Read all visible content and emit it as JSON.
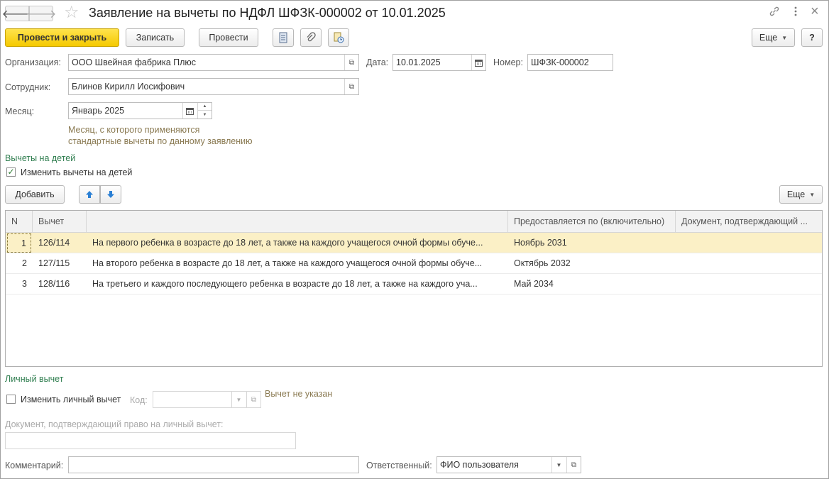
{
  "window": {
    "title": "Заявление на вычеты по НДФЛ ШФЗК-000002 от 10.01.2025",
    "nav_back": "🡐",
    "nav_forward": "🡒",
    "favorite_icon": "star-icon",
    "link_icon": "link-icon",
    "more_icon": "vertical-dots-icon",
    "close_glyph": "×"
  },
  "toolbar": {
    "post_and_close": "Провести и закрыть",
    "save": "Записать",
    "post": "Провести",
    "more": "Еще",
    "help": "?"
  },
  "form": {
    "organization_label": "Организация:",
    "organization_value": "ООО Швейная фабрика Плюс",
    "date_label": "Дата:",
    "date_value": "10.01.2025",
    "number_label": "Номер:",
    "number_value": "ШФЗК-000002",
    "employee_label": "Сотрудник:",
    "employee_value": "Блинов Кирилл Иосифович",
    "month_label": "Месяц:",
    "month_value": "Январь 2025",
    "month_hint_line1": "Месяц, с которого применяются",
    "month_hint_line2": "стандартные вычеты по данному заявлению"
  },
  "children": {
    "section_title": "Вычеты на детей",
    "change_checkbox_label": "Изменить вычеты на детей",
    "change_checked": true,
    "add_button": "Добавить",
    "more_button": "Еще",
    "table": {
      "columns": [
        "N",
        "Вычет",
        "",
        "Предоставляется по (включительно)",
        "Документ, подтверждающий ..."
      ],
      "rows": [
        {
          "n": "1",
          "code": "126/114",
          "description": "На первого ребенка в возрасте до 18 лет, а также на каждого учащегося очной формы обуче...",
          "until": "Ноябрь 2031",
          "document": ""
        },
        {
          "n": "2",
          "code": "127/115",
          "description": "На второго ребенка в возрасте до 18 лет, а также на каждого учащегося очной формы обуче...",
          "until": "Октябрь 2032",
          "document": ""
        },
        {
          "n": "3",
          "code": "128/116",
          "description": "На третьего и каждого последующего ребенка в возрасте до 18 лет, а также на каждого уча...",
          "until": "Май 2034",
          "document": ""
        }
      ],
      "selected_row": 1
    }
  },
  "personal": {
    "section_title": "Личный вычет",
    "change_checkbox_label": "Изменить личный вычет",
    "change_checked": false,
    "code_label": "Код:",
    "code_value": "",
    "status_text": "Вычет не указан",
    "document_label": "Документ, подтверждающий право на личный вычет:",
    "document_value": ""
  },
  "footer": {
    "comment_label": "Комментарий:",
    "comment_value": "",
    "responsible_label": "Ответственный:",
    "responsible_value": "ФИО пользователя"
  },
  "colors": {
    "primary_button": "#f5c900",
    "section_title": "#2e7d4e",
    "hint_text": "#8a7a52",
    "selected_row": "#fbf0c6",
    "arrow_button": "#2a7fd4"
  }
}
